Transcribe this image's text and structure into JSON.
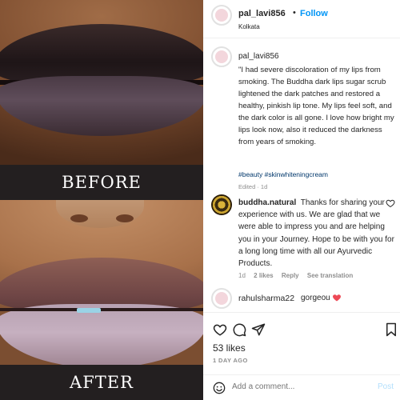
{
  "media": {
    "before_label": "BEFORE",
    "after_label": "AFTER"
  },
  "header": {
    "username": "pal_lavi856",
    "dot": "•",
    "follow_label": "Follow",
    "location": "Kolkata"
  },
  "caption": {
    "username": "pal_lavi856",
    "text": "\"I had severe discoloration of my lips from smoking. The Buddha dark lips sugar scrub lightened the dark patches and restored a healthy, pinkish lip tone. My lips feel soft, and the dark color is all gone. I love how bright my lips look now, also it reduced the darkness from years of smoking.",
    "tags": "#beauty #skinwhiteningcream",
    "edited": "Edited · 1d"
  },
  "comments": [
    {
      "username": "buddha.natural",
      "text": "Thanks for sharing your experience with us. We are glad that we were able to impress you and are helping you in your Journey. Hope to be with you for a long long time with all our Ayurvedic Products.",
      "time": "1d",
      "likes": "2 likes",
      "reply": "Reply",
      "translate": "See translation"
    },
    {
      "username": "rahulsharma22",
      "text": "gorgeou"
    }
  ],
  "stats": {
    "likes": "53 likes",
    "ago": "1 DAY AGO"
  },
  "comment_box": {
    "placeholder": "Add a comment...",
    "post_label": "Post"
  },
  "colors": {
    "follow": "#0095f6",
    "heart_red": "#ed4956",
    "post_disabled": "#b2dffc"
  },
  "icons": [
    "heart-icon",
    "comment-icon",
    "share-icon",
    "bookmark-icon",
    "emoji-icon"
  ]
}
